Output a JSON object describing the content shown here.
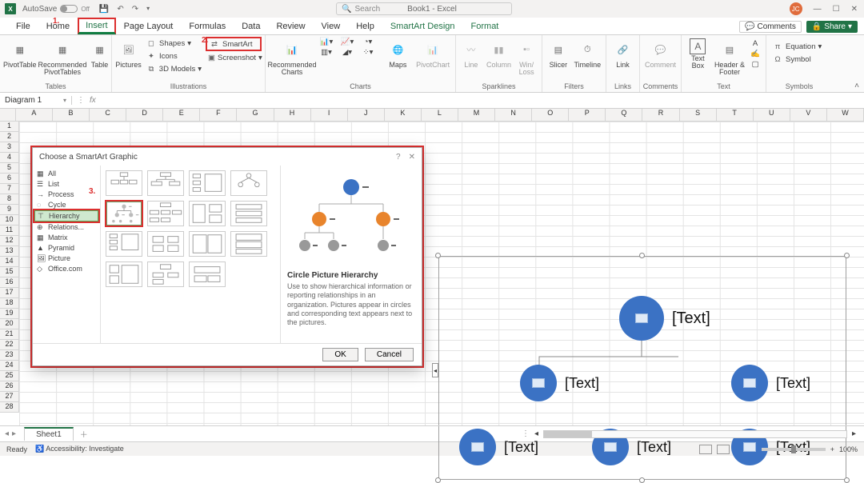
{
  "titlebar": {
    "autosave_label": "AutoSave",
    "autosave_state": "Off",
    "title": "Book1 - Excel",
    "search_placeholder": "Search",
    "avatar_initials": "JC"
  },
  "annotations": {
    "one": "1.",
    "two": "2.",
    "three": "3."
  },
  "tabs": {
    "file": "File",
    "home": "Home",
    "insert": "Insert",
    "page_layout": "Page Layout",
    "formulas": "Formulas",
    "data": "Data",
    "review": "Review",
    "view": "View",
    "help": "Help",
    "smartart_design": "SmartArt Design",
    "format": "Format",
    "comments_btn": "Comments",
    "share_btn": "Share"
  },
  "ribbon": {
    "tables": {
      "pivot": "PivotTable",
      "rec": "Recommended\nPivotTables",
      "table": "Table",
      "group": "Tables"
    },
    "illustrations": {
      "pictures": "Pictures",
      "shapes": "Shapes",
      "icons": "Icons",
      "models": "3D Models",
      "smartart": "SmartArt",
      "screenshot": "Screenshot",
      "group": "Illustrations"
    },
    "charts": {
      "rec": "Recommended\nCharts",
      "maps": "Maps",
      "pivot": "PivotChart",
      "group": "Charts"
    },
    "sparklines": {
      "line": "Line",
      "column": "Column",
      "winloss": "Win/\nLoss",
      "group": "Sparklines"
    },
    "filters": {
      "slicer": "Slicer",
      "timeline": "Timeline",
      "group": "Filters"
    },
    "links": {
      "link": "Link",
      "group": "Links"
    },
    "comments": {
      "comment": "Comment",
      "group": "Comments"
    },
    "text": {
      "textbox": "Text\nBox",
      "header": "Header &\nFooter",
      "group": "Text"
    },
    "symbols": {
      "equation": "Equation",
      "symbol": "Symbol",
      "group": "Symbols"
    }
  },
  "formulabar": {
    "name": "Diagram 1",
    "fx": "fx"
  },
  "columns": [
    "A",
    "B",
    "C",
    "D",
    "E",
    "F",
    "G",
    "H",
    "I",
    "J",
    "K",
    "L",
    "M",
    "N",
    "O",
    "P",
    "Q",
    "R",
    "S",
    "T",
    "U",
    "V",
    "W"
  ],
  "rows_count": 28,
  "dialog": {
    "title": "Choose a SmartArt Graphic",
    "categories": {
      "all": "All",
      "list": "List",
      "process": "Process",
      "cycle": "Cycle",
      "hierarchy": "Hierarchy",
      "relationship": "Relations...",
      "matrix": "Matrix",
      "pyramid": "Pyramid",
      "picture": "Picture",
      "office": "Office.com"
    },
    "preview_title": "Circle Picture Hierarchy",
    "preview_desc": "Use to show hierarchical information or reporting relationships in an organization. Pictures appear in circles and corresponding text appears next to the pictures.",
    "ok": "OK",
    "cancel": "Cancel"
  },
  "smartart": {
    "placeholder": "[Text]"
  },
  "sheettabs": {
    "sheet1": "Sheet1"
  },
  "statusbar": {
    "ready": "Ready",
    "accessibility": "Accessibility: Investigate",
    "zoom": "100%"
  }
}
